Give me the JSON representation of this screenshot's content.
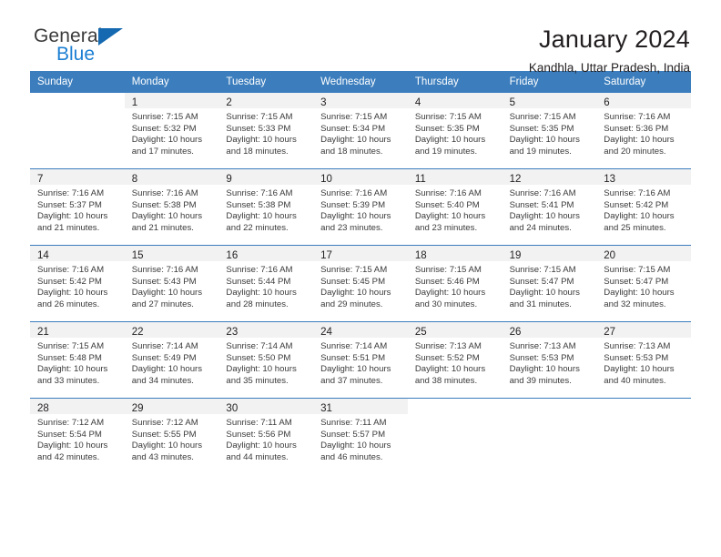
{
  "brand": {
    "name_top": "General",
    "name_bottom": "Blue",
    "triangle_icon": "brand-triangle-icon",
    "color_dark": "#3b3b3b",
    "color_blue": "#1c7fd3"
  },
  "header": {
    "title": "January 2024",
    "subtitle": "Kandhla, Uttar Pradesh, India"
  },
  "theme": {
    "header_bar": "#3b7dbd",
    "daynum_band": "#f2f2f2",
    "text": "#231f20"
  },
  "weekdays": [
    "Sunday",
    "Monday",
    "Tuesday",
    "Wednesday",
    "Thursday",
    "Friday",
    "Saturday"
  ],
  "weeks": [
    [
      {
        "day": "",
        "sunrise": "",
        "sunset": "",
        "daylight_line1": "",
        "daylight_line2": ""
      },
      {
        "day": "1",
        "sunrise": "Sunrise: 7:15 AM",
        "sunset": "Sunset: 5:32 PM",
        "daylight_line1": "Daylight: 10 hours",
        "daylight_line2": "and 17 minutes."
      },
      {
        "day": "2",
        "sunrise": "Sunrise: 7:15 AM",
        "sunset": "Sunset: 5:33 PM",
        "daylight_line1": "Daylight: 10 hours",
        "daylight_line2": "and 18 minutes."
      },
      {
        "day": "3",
        "sunrise": "Sunrise: 7:15 AM",
        "sunset": "Sunset: 5:34 PM",
        "daylight_line1": "Daylight: 10 hours",
        "daylight_line2": "and 18 minutes."
      },
      {
        "day": "4",
        "sunrise": "Sunrise: 7:15 AM",
        "sunset": "Sunset: 5:35 PM",
        "daylight_line1": "Daylight: 10 hours",
        "daylight_line2": "and 19 minutes."
      },
      {
        "day": "5",
        "sunrise": "Sunrise: 7:15 AM",
        "sunset": "Sunset: 5:35 PM",
        "daylight_line1": "Daylight: 10 hours",
        "daylight_line2": "and 19 minutes."
      },
      {
        "day": "6",
        "sunrise": "Sunrise: 7:16 AM",
        "sunset": "Sunset: 5:36 PM",
        "daylight_line1": "Daylight: 10 hours",
        "daylight_line2": "and 20 minutes."
      }
    ],
    [
      {
        "day": "7",
        "sunrise": "Sunrise: 7:16 AM",
        "sunset": "Sunset: 5:37 PM",
        "daylight_line1": "Daylight: 10 hours",
        "daylight_line2": "and 21 minutes."
      },
      {
        "day": "8",
        "sunrise": "Sunrise: 7:16 AM",
        "sunset": "Sunset: 5:38 PM",
        "daylight_line1": "Daylight: 10 hours",
        "daylight_line2": "and 21 minutes."
      },
      {
        "day": "9",
        "sunrise": "Sunrise: 7:16 AM",
        "sunset": "Sunset: 5:38 PM",
        "daylight_line1": "Daylight: 10 hours",
        "daylight_line2": "and 22 minutes."
      },
      {
        "day": "10",
        "sunrise": "Sunrise: 7:16 AM",
        "sunset": "Sunset: 5:39 PM",
        "daylight_line1": "Daylight: 10 hours",
        "daylight_line2": "and 23 minutes."
      },
      {
        "day": "11",
        "sunrise": "Sunrise: 7:16 AM",
        "sunset": "Sunset: 5:40 PM",
        "daylight_line1": "Daylight: 10 hours",
        "daylight_line2": "and 23 minutes."
      },
      {
        "day": "12",
        "sunrise": "Sunrise: 7:16 AM",
        "sunset": "Sunset: 5:41 PM",
        "daylight_line1": "Daylight: 10 hours",
        "daylight_line2": "and 24 minutes."
      },
      {
        "day": "13",
        "sunrise": "Sunrise: 7:16 AM",
        "sunset": "Sunset: 5:42 PM",
        "daylight_line1": "Daylight: 10 hours",
        "daylight_line2": "and 25 minutes."
      }
    ],
    [
      {
        "day": "14",
        "sunrise": "Sunrise: 7:16 AM",
        "sunset": "Sunset: 5:42 PM",
        "daylight_line1": "Daylight: 10 hours",
        "daylight_line2": "and 26 minutes."
      },
      {
        "day": "15",
        "sunrise": "Sunrise: 7:16 AM",
        "sunset": "Sunset: 5:43 PM",
        "daylight_line1": "Daylight: 10 hours",
        "daylight_line2": "and 27 minutes."
      },
      {
        "day": "16",
        "sunrise": "Sunrise: 7:16 AM",
        "sunset": "Sunset: 5:44 PM",
        "daylight_line1": "Daylight: 10 hours",
        "daylight_line2": "and 28 minutes."
      },
      {
        "day": "17",
        "sunrise": "Sunrise: 7:15 AM",
        "sunset": "Sunset: 5:45 PM",
        "daylight_line1": "Daylight: 10 hours",
        "daylight_line2": "and 29 minutes."
      },
      {
        "day": "18",
        "sunrise": "Sunrise: 7:15 AM",
        "sunset": "Sunset: 5:46 PM",
        "daylight_line1": "Daylight: 10 hours",
        "daylight_line2": "and 30 minutes."
      },
      {
        "day": "19",
        "sunrise": "Sunrise: 7:15 AM",
        "sunset": "Sunset: 5:47 PM",
        "daylight_line1": "Daylight: 10 hours",
        "daylight_line2": "and 31 minutes."
      },
      {
        "day": "20",
        "sunrise": "Sunrise: 7:15 AM",
        "sunset": "Sunset: 5:47 PM",
        "daylight_line1": "Daylight: 10 hours",
        "daylight_line2": "and 32 minutes."
      }
    ],
    [
      {
        "day": "21",
        "sunrise": "Sunrise: 7:15 AM",
        "sunset": "Sunset: 5:48 PM",
        "daylight_line1": "Daylight: 10 hours",
        "daylight_line2": "and 33 minutes."
      },
      {
        "day": "22",
        "sunrise": "Sunrise: 7:14 AM",
        "sunset": "Sunset: 5:49 PM",
        "daylight_line1": "Daylight: 10 hours",
        "daylight_line2": "and 34 minutes."
      },
      {
        "day": "23",
        "sunrise": "Sunrise: 7:14 AM",
        "sunset": "Sunset: 5:50 PM",
        "daylight_line1": "Daylight: 10 hours",
        "daylight_line2": "and 35 minutes."
      },
      {
        "day": "24",
        "sunrise": "Sunrise: 7:14 AM",
        "sunset": "Sunset: 5:51 PM",
        "daylight_line1": "Daylight: 10 hours",
        "daylight_line2": "and 37 minutes."
      },
      {
        "day": "25",
        "sunrise": "Sunrise: 7:13 AM",
        "sunset": "Sunset: 5:52 PM",
        "daylight_line1": "Daylight: 10 hours",
        "daylight_line2": "and 38 minutes."
      },
      {
        "day": "26",
        "sunrise": "Sunrise: 7:13 AM",
        "sunset": "Sunset: 5:53 PM",
        "daylight_line1": "Daylight: 10 hours",
        "daylight_line2": "and 39 minutes."
      },
      {
        "day": "27",
        "sunrise": "Sunrise: 7:13 AM",
        "sunset": "Sunset: 5:53 PM",
        "daylight_line1": "Daylight: 10 hours",
        "daylight_line2": "and 40 minutes."
      }
    ],
    [
      {
        "day": "28",
        "sunrise": "Sunrise: 7:12 AM",
        "sunset": "Sunset: 5:54 PM",
        "daylight_line1": "Daylight: 10 hours",
        "daylight_line2": "and 42 minutes."
      },
      {
        "day": "29",
        "sunrise": "Sunrise: 7:12 AM",
        "sunset": "Sunset: 5:55 PM",
        "daylight_line1": "Daylight: 10 hours",
        "daylight_line2": "and 43 minutes."
      },
      {
        "day": "30",
        "sunrise": "Sunrise: 7:11 AM",
        "sunset": "Sunset: 5:56 PM",
        "daylight_line1": "Daylight: 10 hours",
        "daylight_line2": "and 44 minutes."
      },
      {
        "day": "31",
        "sunrise": "Sunrise: 7:11 AM",
        "sunset": "Sunset: 5:57 PM",
        "daylight_line1": "Daylight: 10 hours",
        "daylight_line2": "and 46 minutes."
      },
      {
        "day": "",
        "sunrise": "",
        "sunset": "",
        "daylight_line1": "",
        "daylight_line2": ""
      },
      {
        "day": "",
        "sunrise": "",
        "sunset": "",
        "daylight_line1": "",
        "daylight_line2": ""
      },
      {
        "day": "",
        "sunrise": "",
        "sunset": "",
        "daylight_line1": "",
        "daylight_line2": ""
      }
    ]
  ]
}
